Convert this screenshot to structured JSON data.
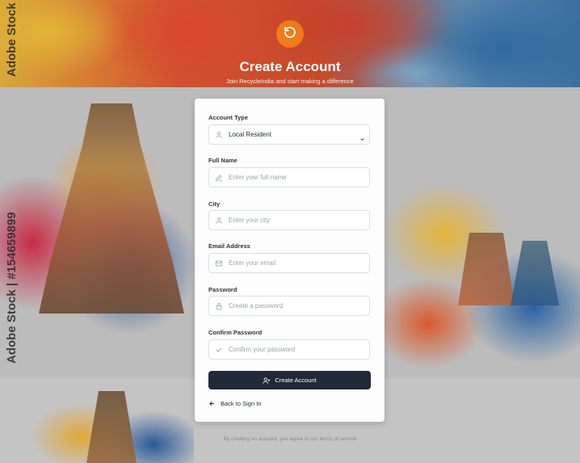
{
  "header": {
    "title": "Create Account",
    "subtitle": "Join RecycleIndia and start making a difference"
  },
  "form": {
    "account_type": {
      "label": "Account Type",
      "value": "Local Resident"
    },
    "full_name": {
      "label": "Full Name",
      "placeholder": "Enter your full name"
    },
    "city": {
      "label": "City",
      "placeholder": "Enter your city"
    },
    "email": {
      "label": "Email Address",
      "placeholder": "Enter your email"
    },
    "password": {
      "label": "Password",
      "placeholder": "Create a password"
    },
    "confirm_password": {
      "label": "Confirm Password",
      "placeholder": "Confirm your password"
    },
    "submit_label": "Create Account",
    "back_label": "Back to Sign In"
  },
  "footer": {
    "text": "By creating an account, you agree to our terms of service"
  },
  "watermark": {
    "top": "Adobe Stock |",
    "side": "Adobe Stock | #154659899"
  },
  "colors": {
    "accent": "#f07a1c",
    "primary_button": "#1f2937"
  },
  "icons": {
    "logo": "recycle-icon",
    "account_type": "user-icon",
    "full_name": "pencil-icon",
    "city": "user-icon",
    "email": "mail-icon",
    "password": "lock-icon",
    "confirm_password": "check-icon",
    "submit": "user-plus-icon",
    "back": "arrow-left-icon"
  }
}
